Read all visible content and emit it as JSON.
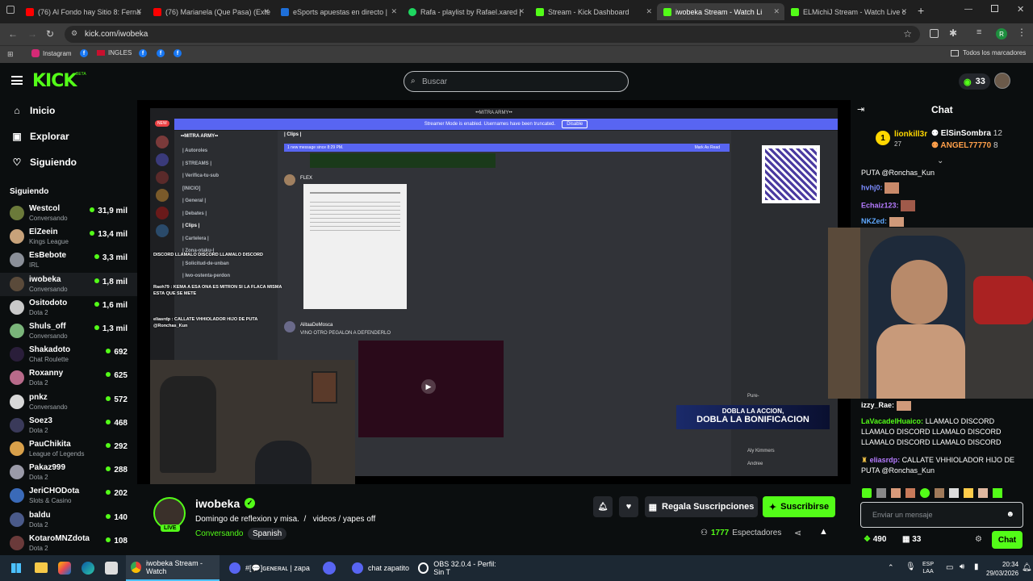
{
  "tabs": [
    {
      "title": "(76) Al Fondo hay Sitio 8: Ferna",
      "color": "#ff0000"
    },
    {
      "title": "(76) Marianela (Que Pasa) (Exte",
      "color": "#ff0000"
    },
    {
      "title": "eSports apuestas en directo |",
      "color": "#1e6fd9"
    },
    {
      "title": "Rafa - playlist by Rafael.xared |",
      "color": "#1ed760"
    },
    {
      "title": "Stream - Kick Dashboard",
      "color": "#53fc18"
    },
    {
      "title": "iwobeka Stream - Watch Li",
      "color": "#53fc18"
    },
    {
      "title": "ELMichiJ Stream - Watch Live c",
      "color": "#53fc18"
    }
  ],
  "browser": {
    "url": "kick.com/iwobeka",
    "bookmarks": [
      "Instagram",
      "INGLES"
    ],
    "all_bookmarks": "Todos los marcadores",
    "profile_letter": "R"
  },
  "kick": {
    "logo": "KICK",
    "beta": "BETA",
    "search_placeholder": "Buscar",
    "coins": "33"
  },
  "sidebar": {
    "nav": [
      {
        "label": "Inicio",
        "icon": "home-icon"
      },
      {
        "label": "Explorar",
        "icon": "compass-icon"
      },
      {
        "label": "Siguiendo",
        "icon": "heart-icon"
      }
    ],
    "following_title": "Siguiendo",
    "following": [
      {
        "name": "Westcol",
        "category": "Conversando",
        "viewers": "31,9 mil",
        "color": "#6b7a3a"
      },
      {
        "name": "ElZeein",
        "category": "Kings League",
        "viewers": "13,4 mil",
        "color": "#c8a27a"
      },
      {
        "name": "EsBebote",
        "category": "IRL",
        "viewers": "3,3 mil",
        "color": "#8a8f98"
      },
      {
        "name": "iwobeka",
        "category": "Conversando",
        "viewers": "1,8 mil",
        "color": "#5a4a3a"
      },
      {
        "name": "Ositodoto",
        "category": "Dota 2",
        "viewers": "1,6 mil",
        "color": "#c9c9c9"
      },
      {
        "name": "Shuls_off",
        "category": "Conversando",
        "viewers": "1,3 mil",
        "color": "#7ab57a"
      },
      {
        "name": "Shakadoto",
        "category": "Chat Roulette",
        "viewers": "692",
        "color": "#2a1e3a"
      },
      {
        "name": "Roxanny",
        "category": "Dota 2",
        "viewers": "625",
        "color": "#b86a8a"
      },
      {
        "name": "pnkz",
        "category": "Conversando",
        "viewers": "572",
        "color": "#d8d8d8"
      },
      {
        "name": "Soez3",
        "category": "Dota 2",
        "viewers": "468",
        "color": "#3a3a5a"
      },
      {
        "name": "PauChikita",
        "category": "League of Legends",
        "viewers": "292",
        "color": "#d8a04a"
      },
      {
        "name": "Pakaz999",
        "category": "Dota 2",
        "viewers": "288",
        "color": "#9a9aa8"
      },
      {
        "name": "JeriCHODota",
        "category": "Slots & Casino",
        "viewers": "202",
        "color": "#3a6ab8"
      },
      {
        "name": "baldu",
        "category": "Dota 2",
        "viewers": "140",
        "color": "#4a5a8a"
      },
      {
        "name": "KotaroMNZdota",
        "category": "Dota 2",
        "viewers": "108",
        "color": "#6a3a3a"
      }
    ]
  },
  "video": {
    "banner_text": "Streamer Mode is enabled. Usernames have been truncated.",
    "banner_button": "Disable",
    "new_badge": "NEW",
    "server_name": "••MITRA ARMY••",
    "channel_title": "| Clips |",
    "new_message": "1 new message since 8:29 PM.",
    "mark_read": "Mark As Read",
    "channels": [
      "| Autoroles",
      "| STREAMS |",
      "| Verifica-tu-sub",
      "[INICIO]",
      "| General |",
      "| Debates |",
      "| Clips |",
      "| Cartelera |",
      "| Zona-otaku-|",
      "| Solicitud-de-unban",
      "| Iwo-ostenta-perdon"
    ],
    "msg_author_1": "FLEX",
    "msg_author_2": "AlitaaDeMosca",
    "msg_text_2": "VINO OTRO PEGALON A DEFENDERLO",
    "overlay_chat": [
      "DISCORD LLAMALO DISCORD LLAMALO DISCORD",
      "Raoh79 : KEMA A ESA ONA ES MITRON SI LA FLACA MISMA ESTA QUE SE METE",
      "eliasrdp : CALLATE VHHIOLADOR HIJO DE PUTA @Ronchas_Kun"
    ],
    "promo_line_1": "DOBLA LA ACCION,",
    "promo_line_2": "DOBLA LA BONIFICACION",
    "members": [
      "Aly Kimmers",
      "Andree",
      "Pure-"
    ]
  },
  "streamer": {
    "name": "iwobeka",
    "title": "Domingo de reflexion y misa.  /   videos / yapes off",
    "category": "Conversando",
    "tag": "Spanish",
    "live": "LIVE",
    "gift_label": "Regala Suscripciones",
    "subscribe_label": "Suscribirse",
    "viewers": "1777",
    "viewers_label": "Espectadores"
  },
  "chat": {
    "title": "Chat",
    "leaderboard": [
      {
        "rank": "1",
        "name": "lionkill3r",
        "count": "27"
      },
      {
        "name": "ElSinSombra",
        "count": "12"
      },
      {
        "name": "ANGEL77770",
        "count": "8"
      }
    ],
    "messages_top": [
      {
        "user": "",
        "text": "PUTA @Ronchas_Kun",
        "color": "#ffffff"
      },
      {
        "user": "hvhj0:",
        "text": "",
        "color": "#7b8cff"
      },
      {
        "user": "Echaiz123:",
        "text": "",
        "color": "#b57bff"
      },
      {
        "user": "NKZed:",
        "text": "",
        "color": "#5fa8ff"
      }
    ],
    "messages_bottom": [
      {
        "user": "izzy_Rae:",
        "text": "",
        "color": "#ffffff"
      },
      {
        "user": "LaVacadelHuaico:",
        "text": "LLAMALO DISCORD LLAMALO DISCORD LLAMALO DISCORD LLAMALO DISCORD LLAMALO DISCORD",
        "color": "#53fc18"
      },
      {
        "user": "eliasrdp:",
        "text": "CALLATE VHHIOLADOR HIJO DE PUTA @Ronchas_Kun",
        "color": "#b57bff"
      }
    ],
    "input_placeholder": "Enviar un mensaje",
    "points": "490",
    "gifts": "33",
    "send_label": "Chat"
  },
  "taskbar": {
    "items": [
      "iwobeka Stream - Watch",
      "#[💬]ɢᴇɴᴇʀᴀʟ | zapa",
      "chat zapatito",
      "OBS 32.0.4 - Perfil: Sin T"
    ],
    "lang_1": "ESP",
    "lang_2": "LAA",
    "time": "20:34",
    "date": "29/03/2026"
  }
}
